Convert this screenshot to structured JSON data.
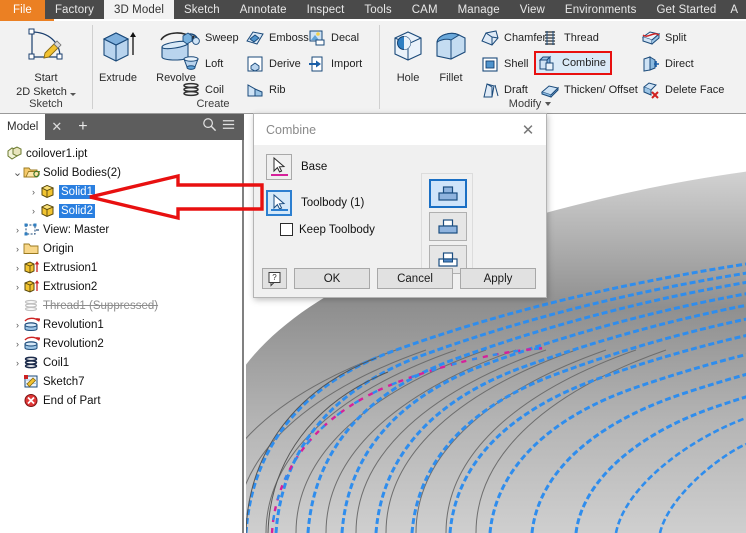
{
  "menubar": {
    "items": [
      {
        "label": "File",
        "state": "file"
      },
      {
        "label": "Factory",
        "state": "normal"
      },
      {
        "label": "3D Model",
        "state": "active"
      },
      {
        "label": "Sketch",
        "state": "normal"
      },
      {
        "label": "Annotate",
        "state": "normal"
      },
      {
        "label": "Inspect",
        "state": "normal"
      },
      {
        "label": "Tools",
        "state": "normal"
      },
      {
        "label": "CAM",
        "state": "normal"
      },
      {
        "label": "Manage",
        "state": "normal"
      },
      {
        "label": "View",
        "state": "normal"
      },
      {
        "label": "Environments",
        "state": "normal"
      },
      {
        "label": "Get Started",
        "state": "normal"
      },
      {
        "label": "A",
        "state": "clipped"
      }
    ]
  },
  "ribbon": {
    "panels": [
      {
        "title": "Sketch"
      },
      {
        "title": "Create"
      },
      {
        "title": "Modify"
      }
    ],
    "sketch": {
      "start_2d_sketch_line1": "Start",
      "start_2d_sketch_line2": "2D Sketch",
      "icon": "sketch-icon"
    },
    "create": {
      "extrude": "Extrude",
      "revolve": "Revolve",
      "sweep": "Sweep",
      "loft": "Loft",
      "coil": "Coil",
      "emboss": "Emboss",
      "derive": "Derive",
      "rib": "Rib",
      "decal": "Decal",
      "import": "Import"
    },
    "modify": {
      "hole": "Hole",
      "fillet": "Fillet",
      "chamfer": "Chamfer",
      "shell": "Shell",
      "draft": "Draft",
      "thread": "Thread",
      "combine": "Combine",
      "thicken_offset": "Thicken/ Offset",
      "split": "Split",
      "direct": "Direct",
      "delete_face": "Delete Face",
      "panel_label": "Modify",
      "highlight_color": "#e81010"
    }
  },
  "browser": {
    "tab_label": "Model",
    "close_glyph": "✕",
    "add_glyph": "+",
    "search_icon": "search-icon",
    "menu_icon": "hamburger-menu-icon",
    "tree": [
      {
        "label": "coilover1.ipt",
        "icon": "part-file-icon",
        "indent": 0,
        "expander": "",
        "selected": false,
        "suppressed": false
      },
      {
        "label": "Solid Bodies(2)",
        "icon": "folder-open-icon",
        "indent": 1,
        "expander": "⌄",
        "selected": false,
        "suppressed": false
      },
      {
        "label": "Solid1",
        "icon": "solid-body-icon",
        "indent": 2,
        "expander": "›",
        "selected": true,
        "suppressed": false
      },
      {
        "label": "Solid2",
        "icon": "solid-body-icon",
        "indent": 2,
        "expander": "›",
        "selected": true,
        "suppressed": false
      },
      {
        "label": "View: Master",
        "icon": "view-icon",
        "indent": 1,
        "expander": "›",
        "selected": false,
        "suppressed": false
      },
      {
        "label": "Origin",
        "icon": "folder-icon",
        "indent": 1,
        "expander": "›",
        "selected": false,
        "suppressed": false
      },
      {
        "label": "Extrusion1",
        "icon": "extrusion-icon",
        "indent": 1,
        "expander": "›",
        "selected": false,
        "suppressed": false
      },
      {
        "label": "Extrusion2",
        "icon": "extrusion-icon",
        "indent": 1,
        "expander": "›",
        "selected": false,
        "suppressed": false
      },
      {
        "label": "Thread1 (Suppressed)",
        "icon": "thread-icon",
        "indent": 1,
        "expander": "",
        "selected": false,
        "suppressed": true
      },
      {
        "label": "Revolution1",
        "icon": "revolution-icon",
        "indent": 1,
        "expander": "›",
        "selected": false,
        "suppressed": false
      },
      {
        "label": "Revolution2",
        "icon": "revolution-icon",
        "indent": 1,
        "expander": "›",
        "selected": false,
        "suppressed": false
      },
      {
        "label": "Coil1",
        "icon": "coil-icon",
        "indent": 1,
        "expander": "›",
        "selected": false,
        "suppressed": false
      },
      {
        "label": "Sketch7",
        "icon": "sketch-feature-icon",
        "indent": 1,
        "expander": "",
        "selected": false,
        "suppressed": false
      },
      {
        "label": "End of Part",
        "icon": "end-of-part-icon",
        "indent": 1,
        "expander": "",
        "selected": false,
        "suppressed": false
      }
    ]
  },
  "dialog": {
    "title": "Combine",
    "close_glyph": "✕",
    "base_label": "Base",
    "base_underline_color": "#d6209b",
    "toolbody_label": "Toolbody (1)",
    "toolbody_underline_color": "#2c7fd0",
    "keep_toolbody_label": "Keep Toolbody",
    "keep_toolbody_checked": false,
    "boolean_options": [
      {
        "name": "join",
        "selected": true
      },
      {
        "name": "cut",
        "selected": false
      },
      {
        "name": "intersect",
        "selected": false
      }
    ],
    "help_label": "?",
    "ok_label": "OK",
    "cancel_label": "Cancel",
    "apply_label": "Apply"
  },
  "viewport": {
    "model_name": "coil-spring-3d-model",
    "body_color": "#a8a8a8",
    "highlight_edge_color": "#2f8ded",
    "sketch_line_color": "#d6209b",
    "background": "#ffffff"
  },
  "annotation": {
    "arrow_color": "#e81010",
    "arrow_name": "red-callout-arrow",
    "points_to": "Solid1 and Solid2"
  }
}
